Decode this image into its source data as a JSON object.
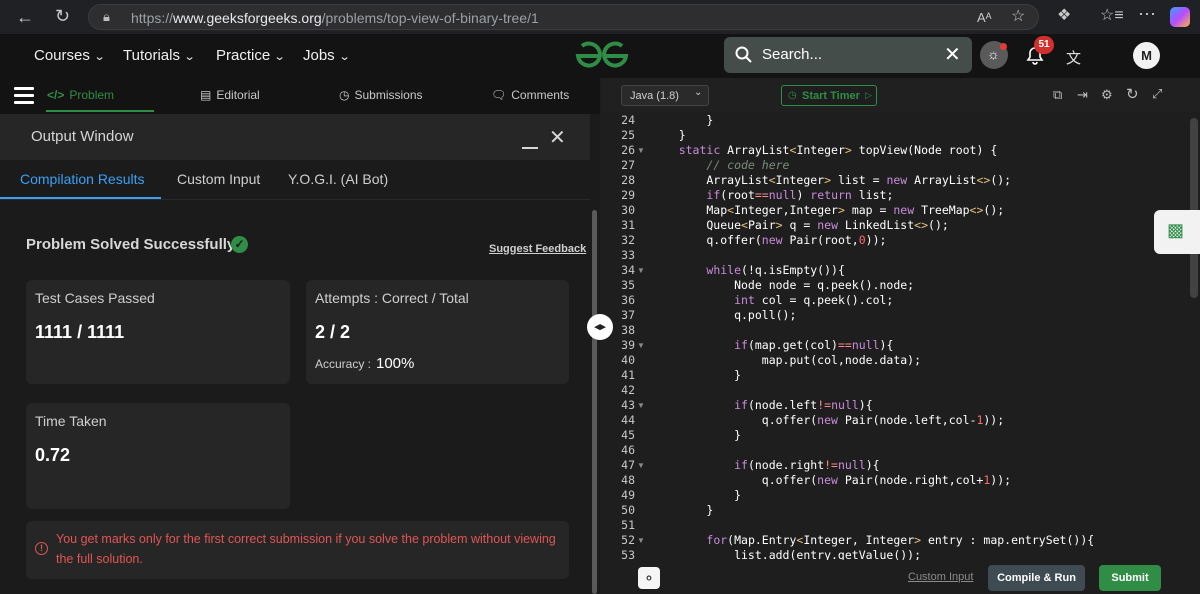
{
  "browser": {
    "url_prefix": "https://",
    "url_host": "www.geeksforgeeks.org",
    "url_path": "/problems/top-view-of-binary-tree/1",
    "reader_label": "Aᴬ"
  },
  "nav": {
    "items": [
      {
        "label": "Courses"
      },
      {
        "label": "Tutorials"
      },
      {
        "label": "Practice"
      },
      {
        "label": "Jobs"
      }
    ],
    "logo": "GfG",
    "search_placeholder": "Search...",
    "notification_count": "51",
    "avatar_initial": "M"
  },
  "problem_tabs": {
    "problem": "Problem",
    "editorial": "Editorial",
    "submissions": "Submissions",
    "comments": "Comments"
  },
  "output_window": {
    "title": "Output Window",
    "tabs": [
      "Compilation Results",
      "Custom Input",
      "Y.O.G.I. (AI Bot)"
    ],
    "status": "Problem Solved Successfully",
    "feedback": "Suggest Feedback",
    "test_cases_label": "Test Cases Passed",
    "test_cases_value": "1111 / 1111",
    "attempts_label": "Attempts : Correct / Total",
    "attempts_value": "2 / 2",
    "accuracy_label": "Accuracy :",
    "accuracy_value": "100%",
    "time_label": "Time Taken",
    "time_value": "0.72",
    "notice": "You get marks only for the first correct submission if you solve the problem without viewing the full solution."
  },
  "editor": {
    "language": "Java (1.8)",
    "timer_label": "Start Timer",
    "custom_input": "Custom Input",
    "compile_run": "Compile & Run",
    "submit": "Submit"
  },
  "code": {
    "line_numbers": [
      "24",
      "25",
      "26",
      "27",
      "28",
      "29",
      "30",
      "31",
      "32",
      "33",
      "34",
      "35",
      "36",
      "37",
      "38",
      "39",
      "40",
      "41",
      "42",
      "43",
      "44",
      "45",
      "46",
      "47",
      "48",
      "49",
      "50",
      "51",
      "52",
      "53"
    ],
    "lines": [
      "        }",
      "    }",
      "    static ArrayList<Integer> topView(Node root) {",
      "        // code here",
      "        ArrayList<Integer> list = new ArrayList<>();",
      "        if(root==null) return list;",
      "        Map<Integer,Integer> map = new TreeMap<>();",
      "        Queue<Pair> q = new LinkedList<>();",
      "        q.offer(new Pair(root,0));",
      "",
      "        while(!q.isEmpty()){",
      "            Node node = q.peek().node;",
      "            int col = q.peek().col;",
      "            q.poll();",
      "",
      "            if(map.get(col)==null){",
      "                map.put(col,node.data);",
      "            }",
      "",
      "            if(node.left!=null){",
      "                q.offer(new Pair(node.left,col-1));",
      "            }",
      "",
      "            if(node.right!=null){",
      "                q.offer(new Pair(node.right,col+1));",
      "            }",
      "        }",
      "",
      "        for(Map.Entry<Integer, Integer> entry : map.entrySet()){",
      "            list.add(entry.getValue());"
    ]
  },
  "colors": {
    "accent_green": "#2f8d46",
    "tab_blue": "#3aa0f5",
    "error_red": "#e05555"
  }
}
